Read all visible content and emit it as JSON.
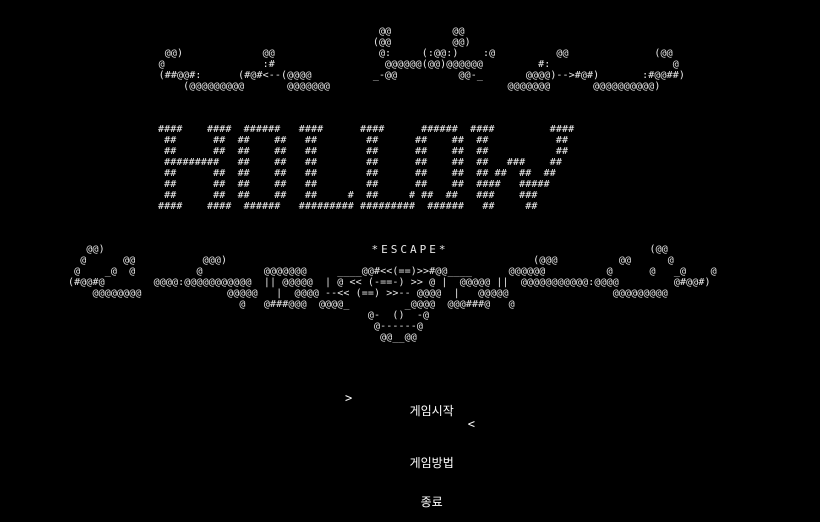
{
  "art": {
    "top": "                                         @@          @@\n                                        (@@          @@)\n      @@)             @@                 @:     (:@@:)    :@          @@              (@@\n     @                :#                  @@@@@@(@@)@@@@@@         #:                    @\n     (##@@#:      (#@#<--(@@@@          _-@@          @@-_       @@@@)-->#@#)       :#@@##)\n         (@@@@@@@@@       @@@@@@@                             @@@@@@@       @@@@@@@@@@)",
    "title": "####    ####  ######   ####      ####      ######  ####         ####\n ##      ##  ##    ##   ##        ##      ##    ##  ##           ##\n ##      ##  ##    ##   ##        ##      ##    ##  ##           ##\n #########   ##    ##   ##        ##      ##    ##  ##   ###    ##\n ##      ##  ##    ##   ##        ##      ##    ##  ## ##  ##  ##\n ##      ##  ##    ##   ##        ##      ##    ##  ####   #####\n ##      ##  ##    ##   ##     #  ##     # ##  ##   ###    ###\n####    ####  ######   ######### #########  ######   ##     ##",
    "bottom": "   @@)                                                                                         (@@\n  @      @@           @@@)                                                  (@@@          @@      @\n @    _@  @          @          @@@@@@@     ____@@#<<(==)>>#@@____      @@@@@@          @      @   _@    @\n(#@@#@        @@@@:@@@@@@@@@@@  || @@@@@  | @ << (-==-) >> @ |  @@@@@ ||  @@@@@@@@@@@:@@@@         @#@@#)\n    @@@@@@@@              @@@@@   |  @@@@ --<< (==) >>-- @@@@  |   @@@@@                 @@@@@@@@@\n                            @   @###@@@  @@@@_         _@@@@  @@@###@   @\n                                                 @-  ()  -@\n                                                  @------@\n                                                   @@__@@"
  },
  "subtitle": "*ESCAPE*",
  "menu": {
    "items": [
      {
        "label": "게임시작",
        "selected": true
      },
      {
        "label": "게임방법",
        "selected": false
      },
      {
        "label": "종료",
        "selected": false
      }
    ],
    "cursor_left": ">",
    "cursor_right": "<"
  },
  "colors": {
    "background": "#000000",
    "foreground": "#ffffff"
  }
}
